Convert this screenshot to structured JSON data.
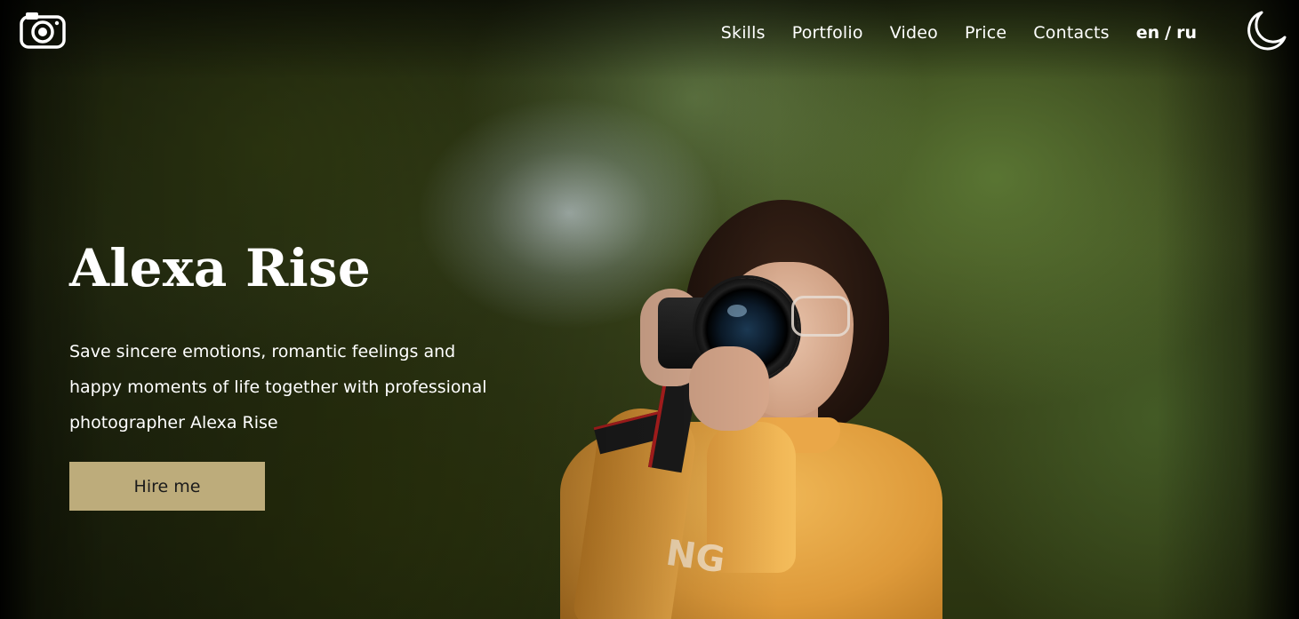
{
  "nav": {
    "logo_icon": "camera-icon",
    "links": [
      "Skills",
      "Portfolio",
      "Video",
      "Price",
      "Contacts"
    ],
    "lang": {
      "en": "en",
      "separator": "/",
      "ru": "ru"
    },
    "theme_icon": "moon-icon"
  },
  "hero": {
    "title": "Alexa Rise",
    "description": "Save sincere emotions, romantic feelings and happy moments of life together with professional photographer Alexa Rise",
    "button_label": "Hire me",
    "sweater_text": "NG"
  },
  "colors": {
    "button_bg": "#bdac7b",
    "text": "#ffffff",
    "accent": "#bdac7b"
  }
}
